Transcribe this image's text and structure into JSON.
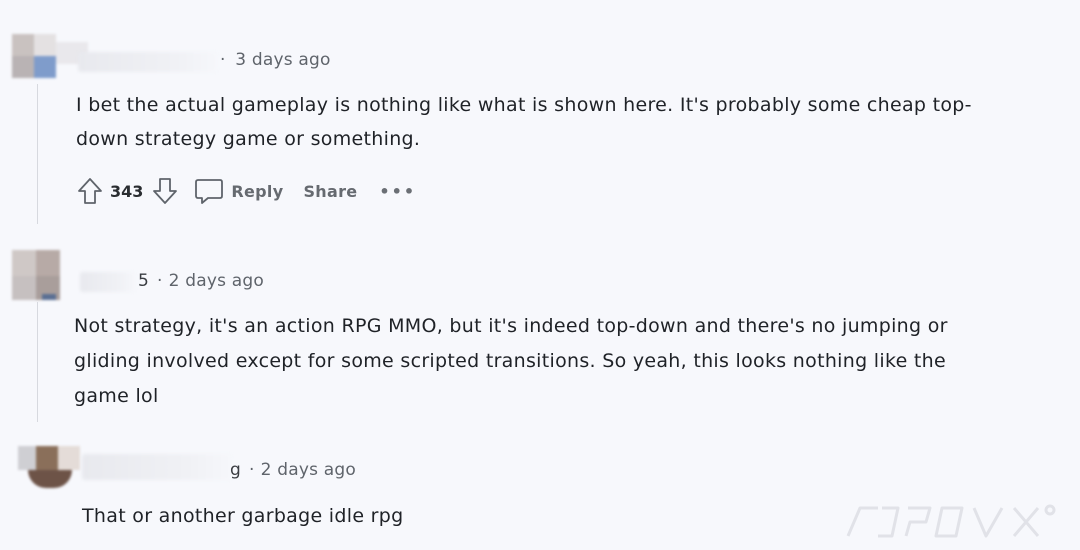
{
  "comments": [
    {
      "author_suffix": "",
      "timestamp": "3 days ago",
      "body": "I bet the actual gameplay is nothing like what is shown here. It's probably some cheap top-down strategy game or something.",
      "body_lines": [
        "I bet the actual gameplay is nothing like what is shown here. It's probably some cheap top-",
        "down strategy game or something."
      ],
      "votes": "343",
      "actions": {
        "reply_label": "Reply",
        "share_label": "Share",
        "more_label": "•••"
      }
    },
    {
      "author_suffix": "5",
      "timestamp": "2 days ago",
      "body_lines": [
        "Not strategy, it's an action RPG MMO, but it's indeed top-down and there's no jumping or",
        "gliding involved except for some scripted transitions. So yeah, this looks nothing like the",
        "game lol"
      ]
    },
    {
      "author_suffix": "g",
      "timestamp": "2 days ago",
      "body_lines": [
        "That or another garbage idle rpg"
      ]
    }
  ],
  "separator": "·",
  "icons": {
    "upvote": "arrow-up-icon",
    "downvote": "arrow-down-icon",
    "reply": "speech-bubble-icon"
  },
  "colors": {
    "background": "#f7f8fc",
    "text": "#1f2227",
    "meta": "#5f646b"
  }
}
